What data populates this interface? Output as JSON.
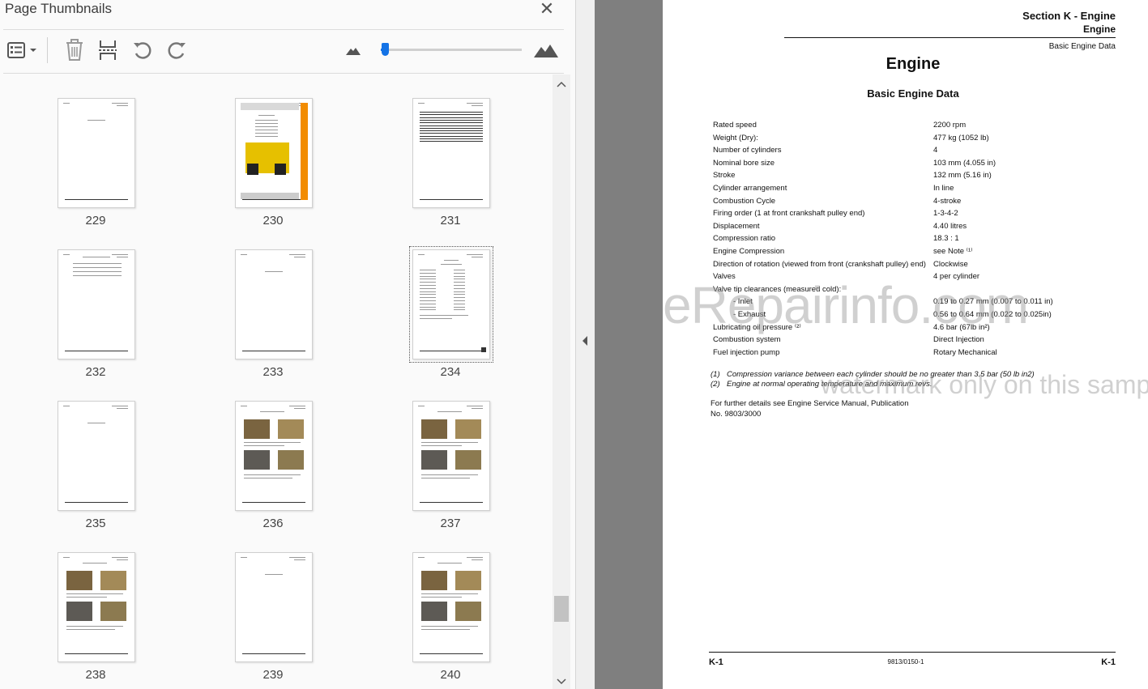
{
  "panel": {
    "title": "Page Thumbnails",
    "close": "✕",
    "thumbnails": [
      {
        "page": "229",
        "kind": "blank"
      },
      {
        "page": "230",
        "kind": "cover"
      },
      {
        "page": "231",
        "kind": "lines"
      },
      {
        "page": "232",
        "kind": "toc"
      },
      {
        "page": "233",
        "kind": "blank"
      },
      {
        "page": "234",
        "kind": "spec",
        "selected": true
      },
      {
        "page": "235",
        "kind": "blank"
      },
      {
        "page": "236",
        "kind": "photos"
      },
      {
        "page": "237",
        "kind": "photos"
      },
      {
        "page": "238",
        "kind": "photos"
      },
      {
        "page": "239",
        "kind": "blank"
      },
      {
        "page": "240",
        "kind": "photos"
      }
    ]
  },
  "document": {
    "section": "Section K - Engine",
    "subsection": "Engine",
    "subsection2": "Basic Engine Data",
    "title": "Engine",
    "subtitle": "Basic Engine Data",
    "specs": [
      {
        "label": "Rated speed",
        "value": "2200 rpm"
      },
      {
        "label": "Weight (Dry):",
        "value": "477 kg (1052 lb)"
      },
      {
        "label": "Number of cylinders",
        "value": "4"
      },
      {
        "label": "Nominal bore size",
        "value": "103 mm (4.055 in)"
      },
      {
        "label": "Stroke",
        "value": "132 mm (5.16 in)"
      },
      {
        "label": "Cylinder arrangement",
        "value": "In line"
      },
      {
        "label": "Combustion Cycle",
        "value": "4-stroke"
      },
      {
        "label": "Firing order (1 at front crankshaft pulley end)",
        "value": "1-3-4-2"
      },
      {
        "label": "Displacement",
        "value": "4.40 litres"
      },
      {
        "label": "Compression ratio",
        "value": "18.3 : 1"
      },
      {
        "label": "Engine Compression",
        "value": "see Note ⁽¹⁾"
      },
      {
        "label": "Direction of rotation (viewed from front (crankshaft pulley) end)",
        "value": "Clockwise"
      },
      {
        "label": "Valves",
        "value": "4 per cylinder"
      },
      {
        "label": "Valve tip clearances (measured cold):",
        "value": ""
      },
      {
        "label": "- Inlet",
        "value": "0.19 to 0.27 mm (0.007 to 0.011 in)",
        "indent": true
      },
      {
        "label": "- Exhaust",
        "value": "0.56 to 0.64 mm (0.022 to 0.025in)",
        "indent": true
      },
      {
        "label": "Lubricating oil pressure ⁽²⁾",
        "value": "4.6 bar (67lb in²)"
      },
      {
        "label": "Combustion system",
        "value": "Direct Injection"
      },
      {
        "label": "Fuel injection pump",
        "value": "Rotary Mechanical"
      }
    ],
    "notes": [
      {
        "num": "(1)",
        "text": "Compression variance between each cylinder should be no greater than 3.5 bar (50 lb in2)"
      },
      {
        "num": "(2)",
        "text": "Engine at normal operating temperature and maximum revs."
      }
    ],
    "further": "For further details see Engine Service Manual, Publication No. 9803/3000",
    "watermark": "eRepairinfo.com",
    "watermark2": "watermark only on this sample",
    "footer_left": "K-1",
    "footer_mid": "9813/0150-1",
    "footer_right": "K-1"
  },
  "colors": {
    "accent": "#1473e6",
    "viewer_gray": "#7f7f7f",
    "panel_bg": "#fafafa"
  }
}
